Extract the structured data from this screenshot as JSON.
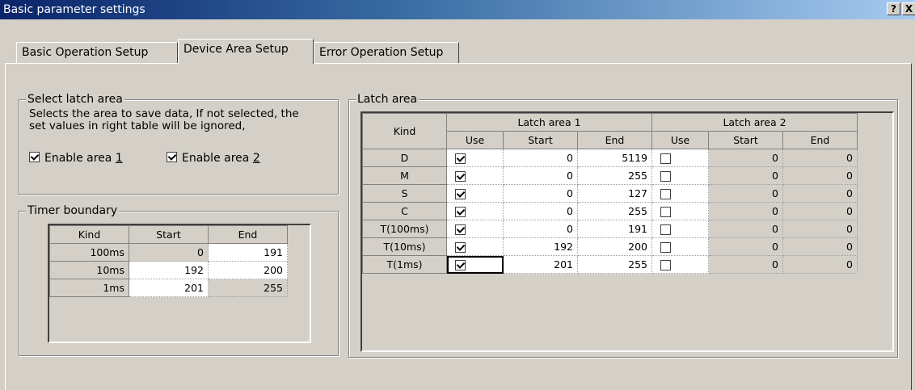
{
  "window": {
    "title": "Basic parameter settings",
    "help_btn": "?",
    "close_btn": "X"
  },
  "tabs": [
    {
      "label": "Basic Operation Setup",
      "active": false
    },
    {
      "label": "Device Area Setup",
      "active": true
    },
    {
      "label": "Error Operation Setup",
      "active": false
    }
  ],
  "select_latch": {
    "title": "Select latch area",
    "description": "Selects the area to save data, If not selected, the set values in right table will be ignored,",
    "area1": {
      "label_prefix": "Enable area ",
      "label_key": "1",
      "checked": true
    },
    "area2": {
      "label_prefix": "Enable area ",
      "label_key": "2",
      "checked": true
    }
  },
  "timer": {
    "title": "Timer boundary",
    "headers": [
      "Kind",
      "Start",
      "End"
    ],
    "rows": [
      {
        "kind": "100ms",
        "start": "0",
        "end": "191"
      },
      {
        "kind": "10ms",
        "start": "192",
        "end": "200"
      },
      {
        "kind": "1ms",
        "start": "201",
        "end": "255"
      }
    ]
  },
  "latch": {
    "title": "Latch area",
    "kind_header": "Kind",
    "group1": "Latch area 1",
    "group2": "Latch area 2",
    "sub_headers": [
      "Use",
      "Start",
      "End"
    ],
    "rows": [
      {
        "kind": "D",
        "use1": true,
        "start1": "0",
        "end1": "5119",
        "use2": false,
        "start2": "0",
        "end2": "0"
      },
      {
        "kind": "M",
        "use1": true,
        "start1": "0",
        "end1": "255",
        "use2": false,
        "start2": "0",
        "end2": "0"
      },
      {
        "kind": "S",
        "use1": true,
        "start1": "0",
        "end1": "127",
        "use2": false,
        "start2": "0",
        "end2": "0"
      },
      {
        "kind": "C",
        "use1": true,
        "start1": "0",
        "end1": "255",
        "use2": false,
        "start2": "0",
        "end2": "0"
      },
      {
        "kind": "T(100ms)",
        "use1": true,
        "start1": "0",
        "end1": "191",
        "use2": false,
        "start2": "0",
        "end2": "0"
      },
      {
        "kind": "T(10ms)",
        "use1": true,
        "start1": "192",
        "end1": "200",
        "use2": false,
        "start2": "0",
        "end2": "0"
      },
      {
        "kind": "T(1ms)",
        "use1": true,
        "start1": "201",
        "end1": "255",
        "use2": false,
        "start2": "0",
        "end2": "0"
      }
    ]
  }
}
